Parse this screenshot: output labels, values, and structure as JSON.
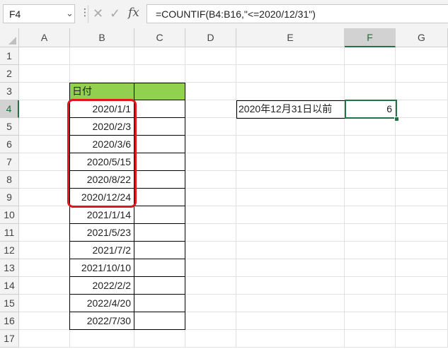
{
  "name_box": "F4",
  "formula": "=COUNTIF(B4:B16,\"<=2020/12/31\")",
  "columns": [
    "A",
    "B",
    "C",
    "D",
    "E",
    "F",
    "G"
  ],
  "rows": [
    "1",
    "2",
    "3",
    "4",
    "5",
    "6",
    "7",
    "8",
    "9",
    "10",
    "11",
    "12",
    "13",
    "14",
    "15",
    "16",
    "17"
  ],
  "header_fill_color": "#92d050",
  "selection_color": "#217346",
  "highlight_color": "#e0161c",
  "table": {
    "header": "日付",
    "dates": [
      "2020/1/1",
      "2020/2/3",
      "2020/3/6",
      "2020/5/15",
      "2020/8/22",
      "2020/12/24",
      "2021/1/14",
      "2021/5/23",
      "2021/7/2",
      "2021/10/10",
      "2022/2/2",
      "2022/4/20",
      "2022/7/30"
    ]
  },
  "label_cell": "2020年12月31日以前",
  "result_cell": "6",
  "icons": {
    "cancel": "cancel-icon",
    "enter": "enter-icon",
    "function": "fx-icon",
    "dropdown": "chevron-down-icon"
  }
}
